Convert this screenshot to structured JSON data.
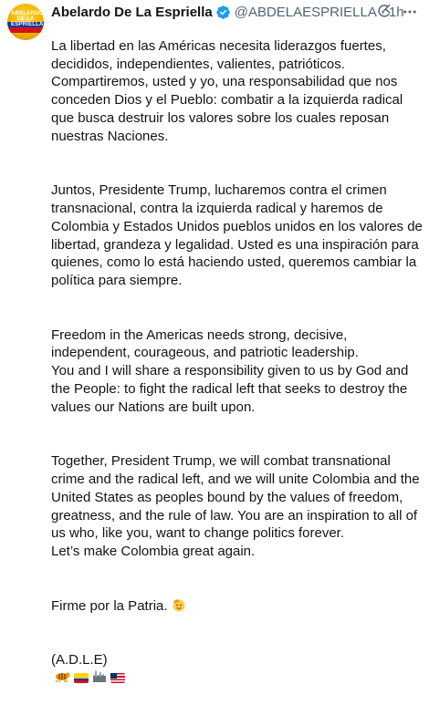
{
  "author": {
    "name": "Abelardo De La Espriella",
    "handle": "@ABDELAESPRIELLA",
    "separator": "·",
    "time": "1h",
    "avatar_text": "ABELARDO DE LA ESPRIELLA"
  },
  "icons": {
    "verified": "verified-badge-icon",
    "grok": "grok-icon",
    "more": "more-options-icon",
    "emoji_face": "saluting-face-emoji",
    "emoji_tiger": "tiger-emoji",
    "emoji_flag_co": "colombia-flag-emoji",
    "emoji_factory": "factory-emoji",
    "emoji_flag_us": "usa-flag-emoji"
  },
  "colors": {
    "text": "#0f1419",
    "secondary": "#536471",
    "verified": "#1d9bf0"
  },
  "tweet": {
    "p1": "La libertad en las Américas necesita liderazgos fuertes, decididos, independientes, valientes, patrióticos.\nCompartiremos, usted y yo, una responsabilidad que nos conceden Dios y el Pueblo: combatir a la izquierda radical que busca destruir los valores sobre los cuales reposan nuestras Naciones.",
    "p2": "Juntos, Presidente Trump, lucharemos contra el crimen transnacional, contra la izquierda radical y haremos de Colombia y Estados Unidos pueblos unidos en los valores de libertad, grandeza y legalidad. Usted es una inspiración para quienes, como lo está haciendo usted, queremos cambiar la política para siempre.",
    "p3": "Freedom in the Americas needs strong, decisive, independent, courageous, and patriotic leadership.\nYou and I will share a responsibility given to us by God and the People: to fight the radical left that seeks to destroy the values our Nations are built upon.",
    "p4": "Together, President Trump, we will combat transnational crime and the radical left, and we will unite Colombia and the United States as peoples bound by the values of freedom, greatness, and the rule of law. You are an inspiration to all of us who, like you, want to change politics forever.\nLet’s make Colombia great again.",
    "p5": "Firme por la Patria.",
    "signature": "(A.D.L.E)"
  }
}
